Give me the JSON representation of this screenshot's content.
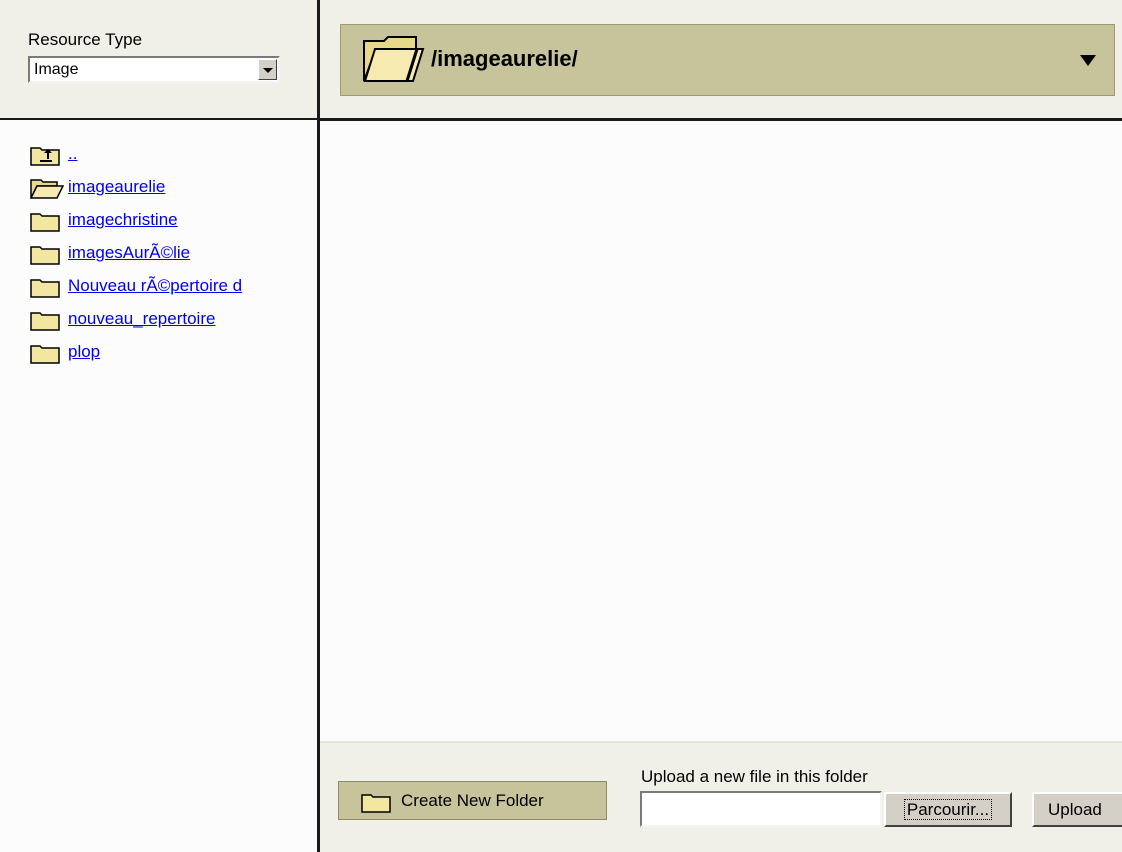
{
  "resource_type": {
    "label": "Resource Type",
    "selected": "Image"
  },
  "current_path": "/imageaurelie/",
  "folders": [
    {
      "name": "..",
      "icon": "parent-folder-icon"
    },
    {
      "name": "imageaurelie",
      "icon": "open-folder-icon"
    },
    {
      "name": "imagechristine",
      "icon": "folder-icon"
    },
    {
      "name": "imagesAurÃ©lie",
      "icon": "folder-icon"
    },
    {
      "name": "Nouveau rÃ©pertoire d",
      "icon": "folder-icon"
    },
    {
      "name": "nouveau_repertoire",
      "icon": "folder-icon"
    },
    {
      "name": "plop",
      "icon": "folder-icon"
    }
  ],
  "toolbar": {
    "create_folder_label": "Create New Folder",
    "upload_label": "Upload a new file in this folder",
    "browse_label": "Parcourir...",
    "upload_button_label": "Upload"
  },
  "colors": {
    "accent_bar": "#c7c39b",
    "panel_bg": "#f0f0e8",
    "link": "#0000ee",
    "separator": "#1a1a1a"
  }
}
